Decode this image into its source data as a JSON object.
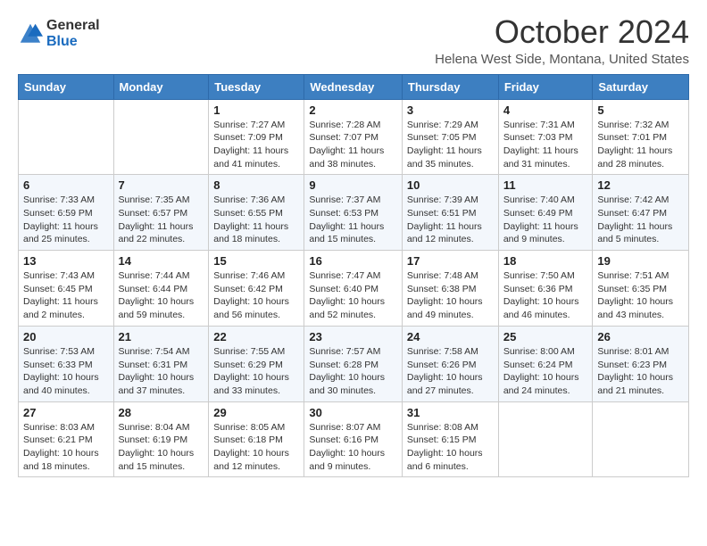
{
  "header": {
    "logo": {
      "general": "General",
      "blue": "Blue"
    },
    "title": "October 2024",
    "location": "Helena West Side, Montana, United States"
  },
  "weekdays": [
    "Sunday",
    "Monday",
    "Tuesday",
    "Wednesday",
    "Thursday",
    "Friday",
    "Saturday"
  ],
  "weeks": [
    [
      {
        "day": "",
        "info": ""
      },
      {
        "day": "",
        "info": ""
      },
      {
        "day": "1",
        "info": "Sunrise: 7:27 AM\nSunset: 7:09 PM\nDaylight: 11 hours and 41 minutes."
      },
      {
        "day": "2",
        "info": "Sunrise: 7:28 AM\nSunset: 7:07 PM\nDaylight: 11 hours and 38 minutes."
      },
      {
        "day": "3",
        "info": "Sunrise: 7:29 AM\nSunset: 7:05 PM\nDaylight: 11 hours and 35 minutes."
      },
      {
        "day": "4",
        "info": "Sunrise: 7:31 AM\nSunset: 7:03 PM\nDaylight: 11 hours and 31 minutes."
      },
      {
        "day": "5",
        "info": "Sunrise: 7:32 AM\nSunset: 7:01 PM\nDaylight: 11 hours and 28 minutes."
      }
    ],
    [
      {
        "day": "6",
        "info": "Sunrise: 7:33 AM\nSunset: 6:59 PM\nDaylight: 11 hours and 25 minutes."
      },
      {
        "day": "7",
        "info": "Sunrise: 7:35 AM\nSunset: 6:57 PM\nDaylight: 11 hours and 22 minutes."
      },
      {
        "day": "8",
        "info": "Sunrise: 7:36 AM\nSunset: 6:55 PM\nDaylight: 11 hours and 18 minutes."
      },
      {
        "day": "9",
        "info": "Sunrise: 7:37 AM\nSunset: 6:53 PM\nDaylight: 11 hours and 15 minutes."
      },
      {
        "day": "10",
        "info": "Sunrise: 7:39 AM\nSunset: 6:51 PM\nDaylight: 11 hours and 12 minutes."
      },
      {
        "day": "11",
        "info": "Sunrise: 7:40 AM\nSunset: 6:49 PM\nDaylight: 11 hours and 9 minutes."
      },
      {
        "day": "12",
        "info": "Sunrise: 7:42 AM\nSunset: 6:47 PM\nDaylight: 11 hours and 5 minutes."
      }
    ],
    [
      {
        "day": "13",
        "info": "Sunrise: 7:43 AM\nSunset: 6:45 PM\nDaylight: 11 hours and 2 minutes."
      },
      {
        "day": "14",
        "info": "Sunrise: 7:44 AM\nSunset: 6:44 PM\nDaylight: 10 hours and 59 minutes."
      },
      {
        "day": "15",
        "info": "Sunrise: 7:46 AM\nSunset: 6:42 PM\nDaylight: 10 hours and 56 minutes."
      },
      {
        "day": "16",
        "info": "Sunrise: 7:47 AM\nSunset: 6:40 PM\nDaylight: 10 hours and 52 minutes."
      },
      {
        "day": "17",
        "info": "Sunrise: 7:48 AM\nSunset: 6:38 PM\nDaylight: 10 hours and 49 minutes."
      },
      {
        "day": "18",
        "info": "Sunrise: 7:50 AM\nSunset: 6:36 PM\nDaylight: 10 hours and 46 minutes."
      },
      {
        "day": "19",
        "info": "Sunrise: 7:51 AM\nSunset: 6:35 PM\nDaylight: 10 hours and 43 minutes."
      }
    ],
    [
      {
        "day": "20",
        "info": "Sunrise: 7:53 AM\nSunset: 6:33 PM\nDaylight: 10 hours and 40 minutes."
      },
      {
        "day": "21",
        "info": "Sunrise: 7:54 AM\nSunset: 6:31 PM\nDaylight: 10 hours and 37 minutes."
      },
      {
        "day": "22",
        "info": "Sunrise: 7:55 AM\nSunset: 6:29 PM\nDaylight: 10 hours and 33 minutes."
      },
      {
        "day": "23",
        "info": "Sunrise: 7:57 AM\nSunset: 6:28 PM\nDaylight: 10 hours and 30 minutes."
      },
      {
        "day": "24",
        "info": "Sunrise: 7:58 AM\nSunset: 6:26 PM\nDaylight: 10 hours and 27 minutes."
      },
      {
        "day": "25",
        "info": "Sunrise: 8:00 AM\nSunset: 6:24 PM\nDaylight: 10 hours and 24 minutes."
      },
      {
        "day": "26",
        "info": "Sunrise: 8:01 AM\nSunset: 6:23 PM\nDaylight: 10 hours and 21 minutes."
      }
    ],
    [
      {
        "day": "27",
        "info": "Sunrise: 8:03 AM\nSunset: 6:21 PM\nDaylight: 10 hours and 18 minutes."
      },
      {
        "day": "28",
        "info": "Sunrise: 8:04 AM\nSunset: 6:19 PM\nDaylight: 10 hours and 15 minutes."
      },
      {
        "day": "29",
        "info": "Sunrise: 8:05 AM\nSunset: 6:18 PM\nDaylight: 10 hours and 12 minutes."
      },
      {
        "day": "30",
        "info": "Sunrise: 8:07 AM\nSunset: 6:16 PM\nDaylight: 10 hours and 9 minutes."
      },
      {
        "day": "31",
        "info": "Sunrise: 8:08 AM\nSunset: 6:15 PM\nDaylight: 10 hours and 6 minutes."
      },
      {
        "day": "",
        "info": ""
      },
      {
        "day": "",
        "info": ""
      }
    ]
  ]
}
